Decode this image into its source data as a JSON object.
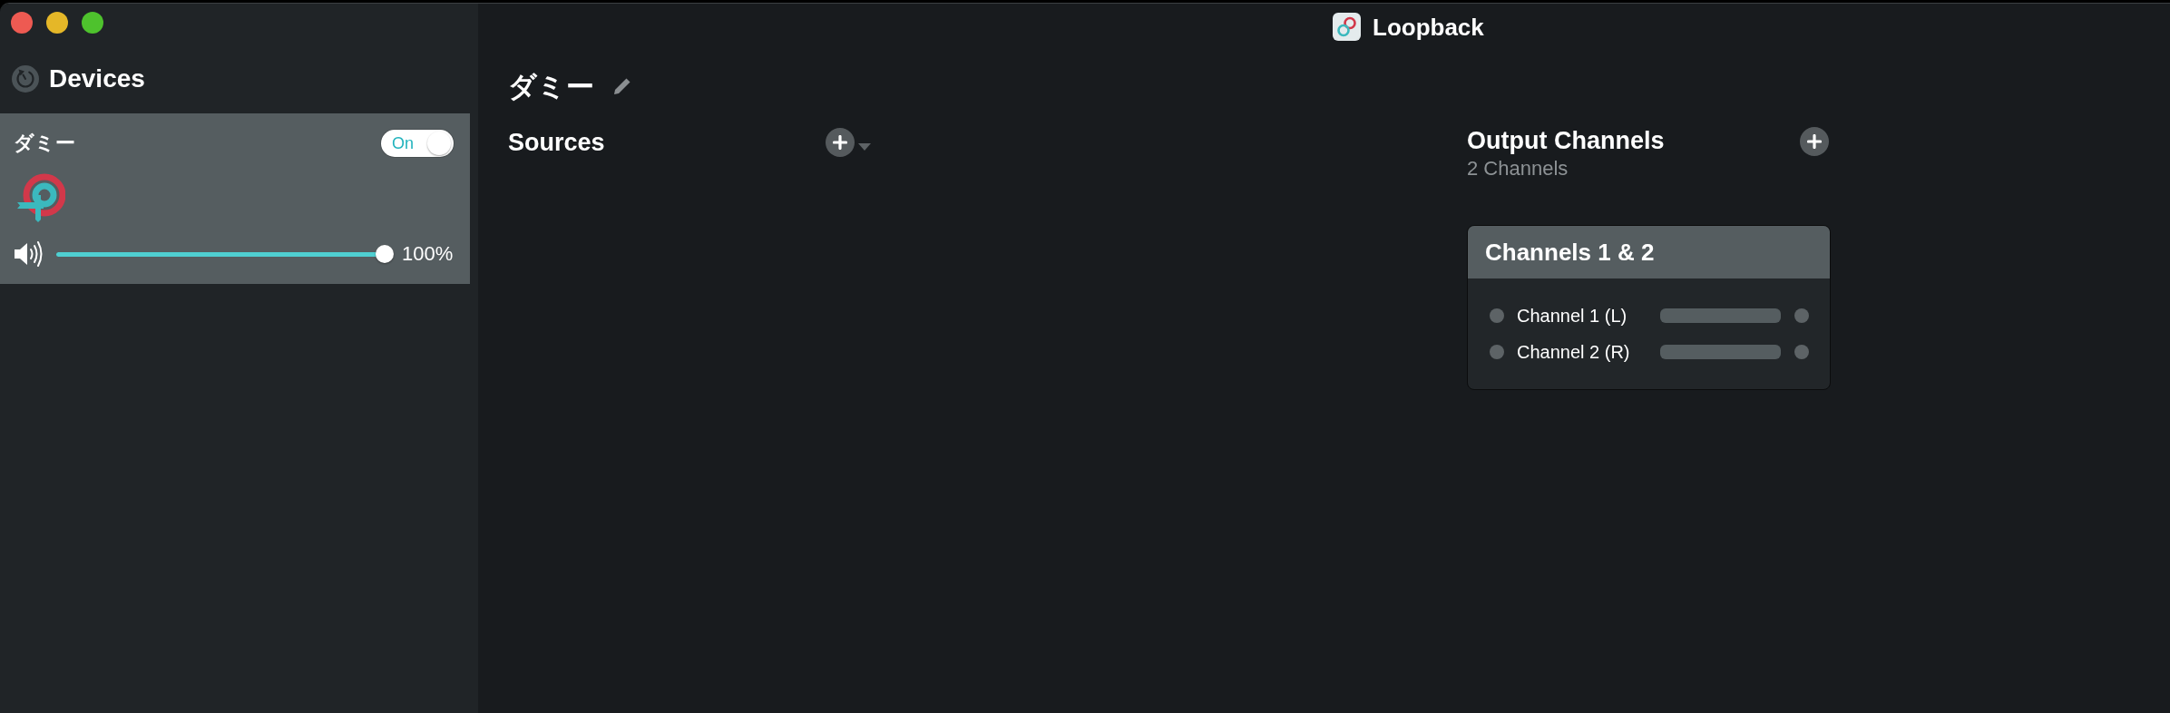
{
  "window": {
    "title": "Loopback"
  },
  "sidebar": {
    "title": "Devices",
    "devices": [
      {
        "name": "ダミー",
        "selected": true,
        "on": true,
        "toggle_label": "On",
        "volume": {
          "level": 1.0,
          "reading": "100%"
        }
      }
    ]
  },
  "main": {
    "device_name": "ダミー",
    "sources": {
      "title": "Sources"
    },
    "output_channels": {
      "title": "Output Channels",
      "subtitle": "2 Channels",
      "groups": [
        {
          "title": "Channels 1 & 2",
          "channels": [
            {
              "label": "Channel 1 (L)"
            },
            {
              "label": "Channel 2 (R)"
            }
          ]
        }
      ]
    }
  }
}
